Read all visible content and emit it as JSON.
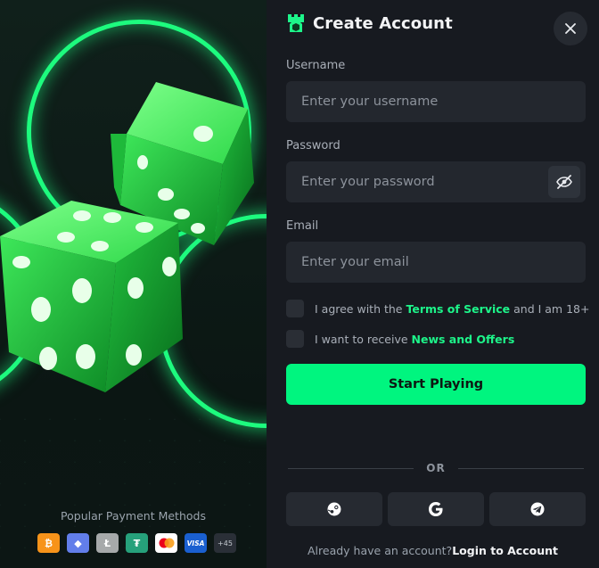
{
  "left_panel": {
    "payments_title": "Popular Payment Methods",
    "payment_methods": [
      {
        "name": "bitcoin-icon",
        "glyph": "₿",
        "color": "#f7931a"
      },
      {
        "name": "ethereum-icon",
        "glyph": "◆",
        "color": "#627eea"
      },
      {
        "name": "litecoin-icon",
        "glyph": "Ł",
        "color": "#a6a9aa"
      },
      {
        "name": "tether-icon",
        "glyph": "₮",
        "color": "#26a17b"
      },
      {
        "name": "mastercard-icon",
        "glyph": "",
        "color": "#ffffff"
      },
      {
        "name": "visa-icon",
        "glyph": "VISA",
        "color": "#1a5fd0"
      }
    ],
    "more_payments": "+45"
  },
  "form": {
    "title": "Create Account",
    "username": {
      "label": "Username",
      "placeholder": "Enter your username"
    },
    "password": {
      "label": "Password",
      "placeholder": "Enter your password"
    },
    "email": {
      "label": "Email",
      "placeholder": "Enter your email"
    },
    "terms": {
      "prefix": "I agree with the ",
      "link": "Terms of Service",
      "suffix": " and I am 18+"
    },
    "news": {
      "prefix": "I want to receive ",
      "link": "News and Offers"
    },
    "submit_label": "Start Playing",
    "or_label": "OR",
    "login_prompt": "Already have an account?",
    "login_link": "Login to Account"
  },
  "colors": {
    "accent": "#00f57f",
    "panel": "#171a20",
    "input": "#23272e"
  }
}
